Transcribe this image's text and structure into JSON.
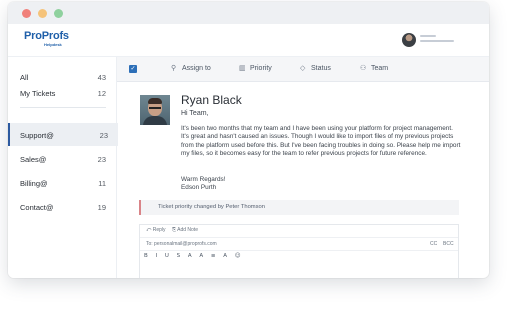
{
  "brand": {
    "logo_main": "ProProfs",
    "logo_sub": "Helpdesk"
  },
  "sidebar": {
    "items": [
      {
        "label": "All",
        "count": "43"
      },
      {
        "label": "My Tickets",
        "count": "12"
      },
      {
        "label": "Support@",
        "count": "23"
      },
      {
        "label": "Sales@",
        "count": "23"
      },
      {
        "label": "Billing@",
        "count": "11"
      },
      {
        "label": "Contact@",
        "count": "19"
      }
    ]
  },
  "toolbar": {
    "assign_label": "Assign to",
    "priority_label": "Priority",
    "status_label": "Status",
    "team_label": "Team"
  },
  "ticket": {
    "name": "Ryan Black",
    "greeting": "Hi Team,",
    "body": "It's been two months that my team and I have been using your platform for project management. It's great and hasn't caused an issues. Though I would like to import files of my previous projects from the platform used before this. But I've been facing troubles in doing so. Please help me import my files, so it becomes easy for the team to refer previous projects for future reference.",
    "regards": "Warm Regards!",
    "signature": "Edson Purth"
  },
  "note": {
    "text": "Ticket priority changed by Peter Thomson"
  },
  "reply": {
    "tab_reply": "Reply",
    "tab_add_note": "Add Note",
    "to": "To: personalmail@proprofs.com",
    "cc": "CC",
    "bcc": "BCC",
    "format_buttons": "B I U S A A ≡ A ☺"
  },
  "colors": {
    "accent": "#2d6fb8",
    "brand": "#1f5fa9",
    "note_border": "#d98488"
  }
}
